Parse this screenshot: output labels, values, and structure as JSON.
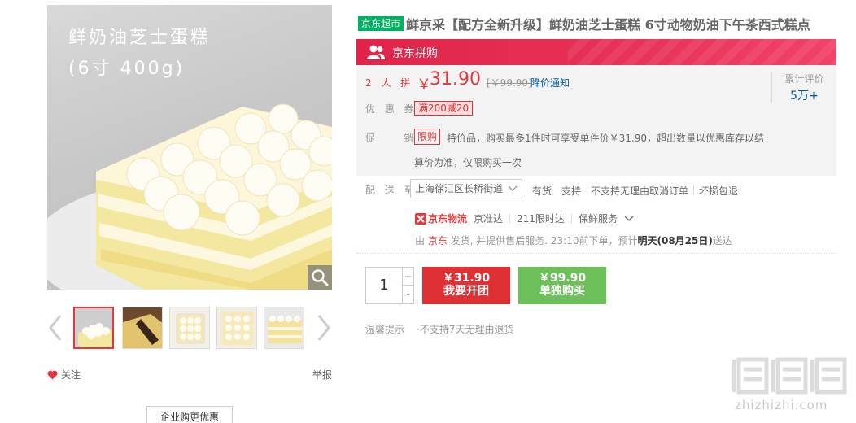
{
  "gallery": {
    "caption_line1": "鲜奶油芝士蛋糕",
    "caption_line2": "(6寸 400g)",
    "thumbnail_count": 5,
    "active_thumbnail": 1
  },
  "actions": {
    "follow_label": "关注",
    "report_label": "举报",
    "business_label": "企业购更优惠"
  },
  "product": {
    "store_tag": "京东超市",
    "title": "鲜京采【配方全新升级】鲜奶油芝士蛋糕 6寸动物奶油下午茶西式糕点"
  },
  "group_buy": {
    "banner_label": "京东拼购",
    "people_label": "2 人 拼",
    "currency": "￥",
    "price": "31.90",
    "original_price": "[￥99.90]",
    "price_notify": "降价通知"
  },
  "reviews": {
    "label": "累计评价",
    "count": "5万+"
  },
  "coupon": {
    "label": "优 惠 券",
    "value": "满200减20"
  },
  "promotion": {
    "label": "促    销",
    "tag": "限购",
    "text_line1": "特价品，购买最多1件时可享受单件价￥31.90，超出数量以优惠库存以结",
    "text_line2": "算价为准，仅限购买一次"
  },
  "shipping": {
    "label": "配 送 至",
    "address": "上海徐汇区长桥街道",
    "items": [
      "有货",
      "支持",
      "不支持无理由取消订单",
      "坏损包退"
    ]
  },
  "logistics": {
    "brand": "京东物流",
    "items": [
      "京准达",
      "211限时达",
      "保鲜服务"
    ],
    "deliver_prefix": "由 ",
    "deliver_by": "京东",
    "deliver_middle": " 发货, 并提供售后服务. 23:10前下单，预计",
    "deliver_date": "明天(08月25日)",
    "deliver_suffix": "送达"
  },
  "purchase": {
    "quantity": "1",
    "plus": "+",
    "minus": "-",
    "group_price": "￥31.90",
    "group_label": "我要开团",
    "single_price": "￥99.90",
    "single_label": "单独购买"
  },
  "tips": {
    "label": "温馨提示",
    "item": "·不支持7天无理由退货"
  },
  "watermark": {
    "url": "zhizhizhi.com"
  },
  "colors": {
    "accent_red": "#e4393c",
    "buy_green": "#6cbf59",
    "store_tag_green": "#00b262",
    "link_blue": "#005aa0"
  }
}
